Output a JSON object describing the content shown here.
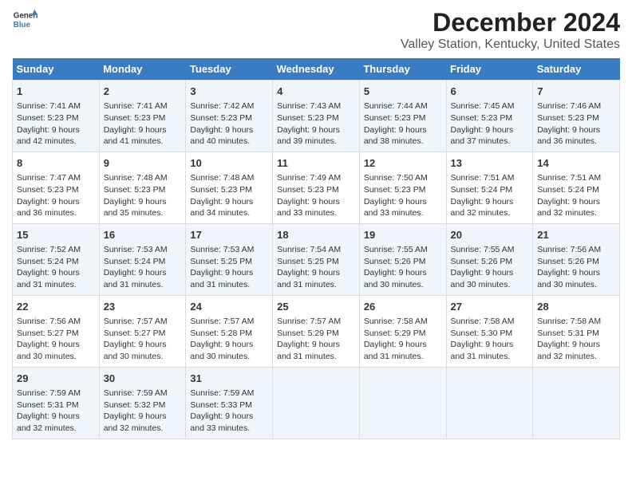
{
  "header": {
    "logo_line1": "General",
    "logo_line2": "Blue",
    "title": "December 2024",
    "subtitle": "Valley Station, Kentucky, United States"
  },
  "weekdays": [
    "Sunday",
    "Monday",
    "Tuesday",
    "Wednesday",
    "Thursday",
    "Friday",
    "Saturday"
  ],
  "weeks": [
    [
      {
        "day": "1",
        "text": "Sunrise: 7:41 AM\nSunset: 5:23 PM\nDaylight: 9 hours\nand 42 minutes."
      },
      {
        "day": "2",
        "text": "Sunrise: 7:41 AM\nSunset: 5:23 PM\nDaylight: 9 hours\nand 41 minutes."
      },
      {
        "day": "3",
        "text": "Sunrise: 7:42 AM\nSunset: 5:23 PM\nDaylight: 9 hours\nand 40 minutes."
      },
      {
        "day": "4",
        "text": "Sunrise: 7:43 AM\nSunset: 5:23 PM\nDaylight: 9 hours\nand 39 minutes."
      },
      {
        "day": "5",
        "text": "Sunrise: 7:44 AM\nSunset: 5:23 PM\nDaylight: 9 hours\nand 38 minutes."
      },
      {
        "day": "6",
        "text": "Sunrise: 7:45 AM\nSunset: 5:23 PM\nDaylight: 9 hours\nand 37 minutes."
      },
      {
        "day": "7",
        "text": "Sunrise: 7:46 AM\nSunset: 5:23 PM\nDaylight: 9 hours\nand 36 minutes."
      }
    ],
    [
      {
        "day": "8",
        "text": "Sunrise: 7:47 AM\nSunset: 5:23 PM\nDaylight: 9 hours\nand 36 minutes."
      },
      {
        "day": "9",
        "text": "Sunrise: 7:48 AM\nSunset: 5:23 PM\nDaylight: 9 hours\nand 35 minutes."
      },
      {
        "day": "10",
        "text": "Sunrise: 7:48 AM\nSunset: 5:23 PM\nDaylight: 9 hours\nand 34 minutes."
      },
      {
        "day": "11",
        "text": "Sunrise: 7:49 AM\nSunset: 5:23 PM\nDaylight: 9 hours\nand 33 minutes."
      },
      {
        "day": "12",
        "text": "Sunrise: 7:50 AM\nSunset: 5:23 PM\nDaylight: 9 hours\nand 33 minutes."
      },
      {
        "day": "13",
        "text": "Sunrise: 7:51 AM\nSunset: 5:24 PM\nDaylight: 9 hours\nand 32 minutes."
      },
      {
        "day": "14",
        "text": "Sunrise: 7:51 AM\nSunset: 5:24 PM\nDaylight: 9 hours\nand 32 minutes."
      }
    ],
    [
      {
        "day": "15",
        "text": "Sunrise: 7:52 AM\nSunset: 5:24 PM\nDaylight: 9 hours\nand 31 minutes."
      },
      {
        "day": "16",
        "text": "Sunrise: 7:53 AM\nSunset: 5:24 PM\nDaylight: 9 hours\nand 31 minutes."
      },
      {
        "day": "17",
        "text": "Sunrise: 7:53 AM\nSunset: 5:25 PM\nDaylight: 9 hours\nand 31 minutes."
      },
      {
        "day": "18",
        "text": "Sunrise: 7:54 AM\nSunset: 5:25 PM\nDaylight: 9 hours\nand 31 minutes."
      },
      {
        "day": "19",
        "text": "Sunrise: 7:55 AM\nSunset: 5:26 PM\nDaylight: 9 hours\nand 30 minutes."
      },
      {
        "day": "20",
        "text": "Sunrise: 7:55 AM\nSunset: 5:26 PM\nDaylight: 9 hours\nand 30 minutes."
      },
      {
        "day": "21",
        "text": "Sunrise: 7:56 AM\nSunset: 5:26 PM\nDaylight: 9 hours\nand 30 minutes."
      }
    ],
    [
      {
        "day": "22",
        "text": "Sunrise: 7:56 AM\nSunset: 5:27 PM\nDaylight: 9 hours\nand 30 minutes."
      },
      {
        "day": "23",
        "text": "Sunrise: 7:57 AM\nSunset: 5:27 PM\nDaylight: 9 hours\nand 30 minutes."
      },
      {
        "day": "24",
        "text": "Sunrise: 7:57 AM\nSunset: 5:28 PM\nDaylight: 9 hours\nand 30 minutes."
      },
      {
        "day": "25",
        "text": "Sunrise: 7:57 AM\nSunset: 5:29 PM\nDaylight: 9 hours\nand 31 minutes."
      },
      {
        "day": "26",
        "text": "Sunrise: 7:58 AM\nSunset: 5:29 PM\nDaylight: 9 hours\nand 31 minutes."
      },
      {
        "day": "27",
        "text": "Sunrise: 7:58 AM\nSunset: 5:30 PM\nDaylight: 9 hours\nand 31 minutes."
      },
      {
        "day": "28",
        "text": "Sunrise: 7:58 AM\nSunset: 5:31 PM\nDaylight: 9 hours\nand 32 minutes."
      }
    ],
    [
      {
        "day": "29",
        "text": "Sunrise: 7:59 AM\nSunset: 5:31 PM\nDaylight: 9 hours\nand 32 minutes."
      },
      {
        "day": "30",
        "text": "Sunrise: 7:59 AM\nSunset: 5:32 PM\nDaylight: 9 hours\nand 32 minutes."
      },
      {
        "day": "31",
        "text": "Sunrise: 7:59 AM\nSunset: 5:33 PM\nDaylight: 9 hours\nand 33 minutes."
      },
      {
        "day": "",
        "text": ""
      },
      {
        "day": "",
        "text": ""
      },
      {
        "day": "",
        "text": ""
      },
      {
        "day": "",
        "text": ""
      }
    ]
  ]
}
